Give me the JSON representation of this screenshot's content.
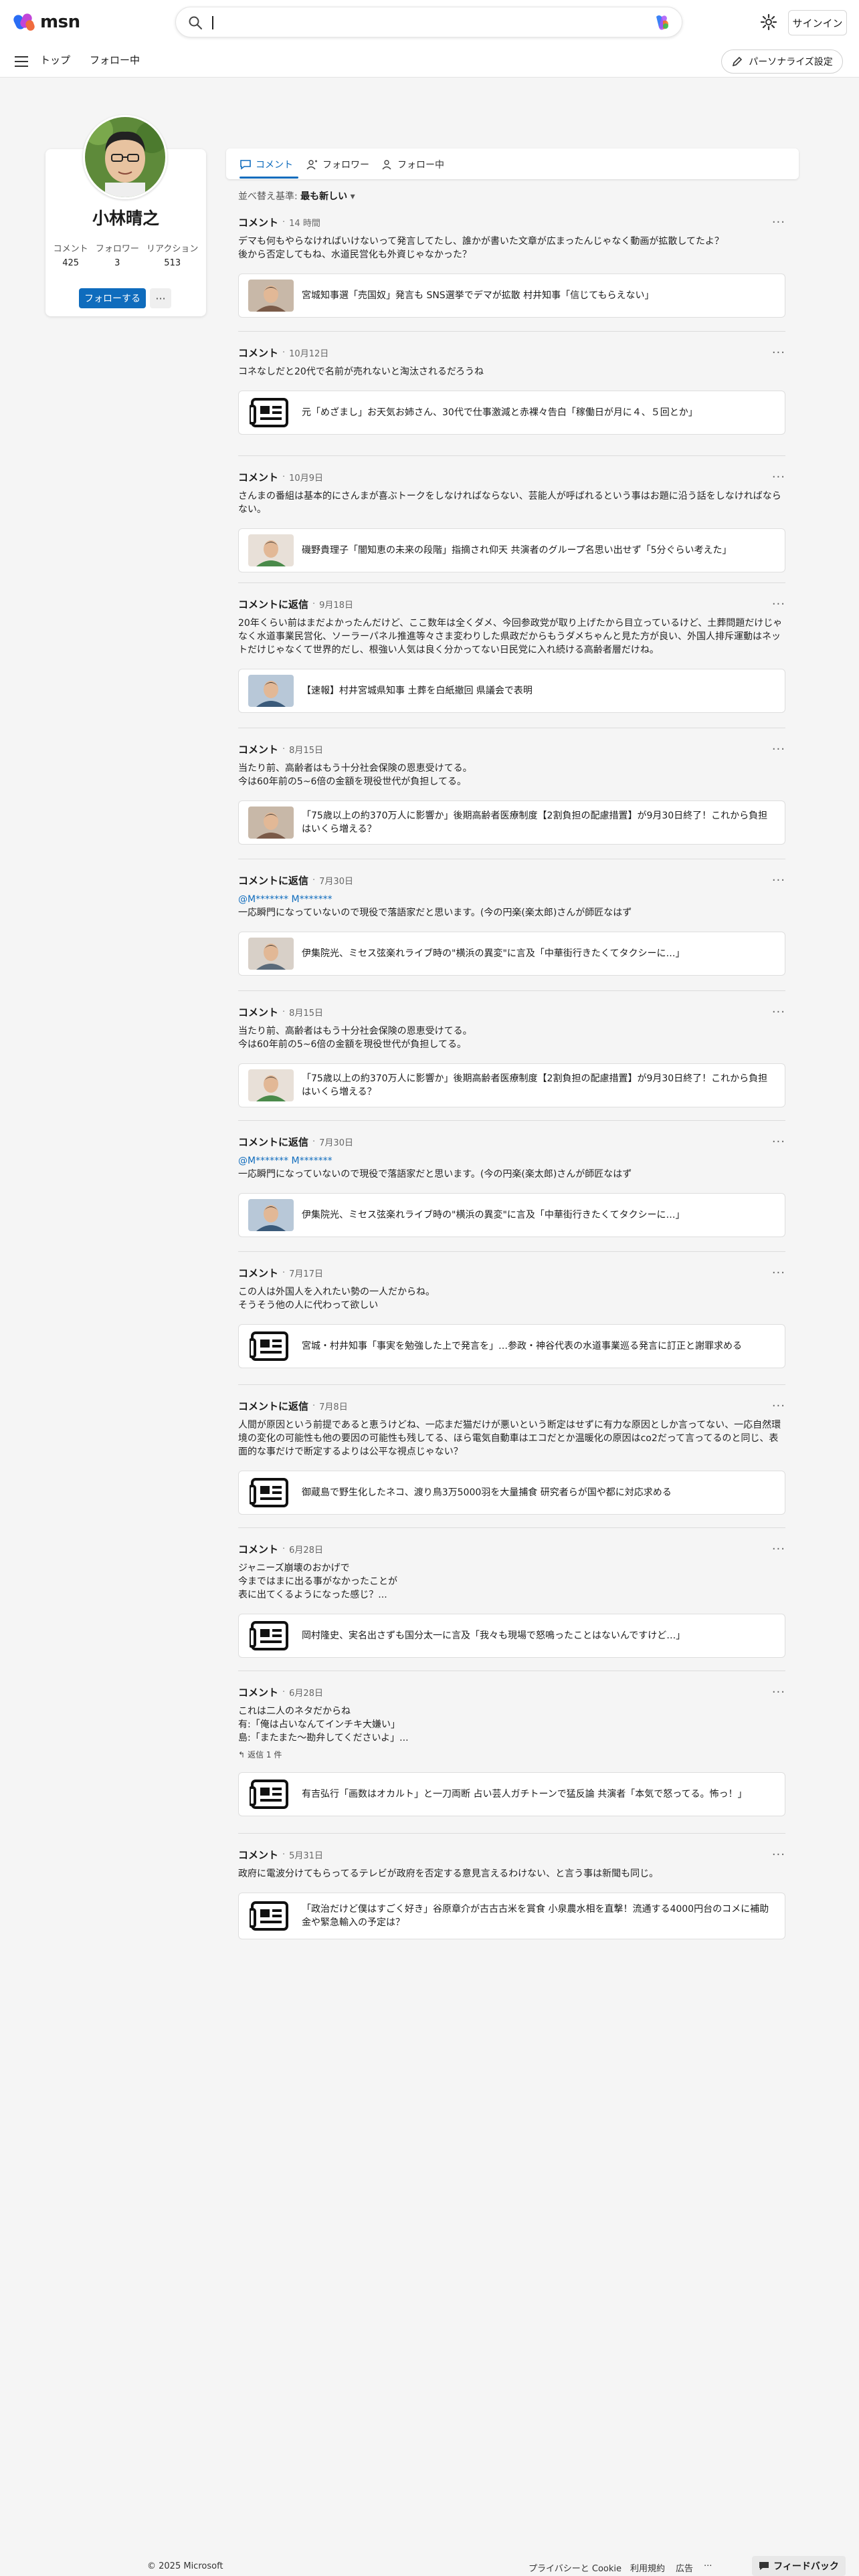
{
  "header": {
    "logo_text": "msn",
    "search_placeholder": "",
    "signin_label": "サインイン"
  },
  "nav": {
    "items": [
      "トップ",
      "フォロー中"
    ],
    "personalize_label": "パーソナライズ設定"
  },
  "profile": {
    "name": "小林晴之",
    "stats": [
      {
        "label": "コメント",
        "value": "425"
      },
      {
        "label": "フォロワー",
        "value": "3"
      },
      {
        "label": "リアクション",
        "value": "513"
      }
    ],
    "follow_label": "フォローする",
    "more_label": "···"
  },
  "tabs": [
    {
      "label": "コメント",
      "icon": "comment-icon",
      "active": true
    },
    {
      "label": "フォロワー",
      "icon": "followers-icon",
      "active": false
    },
    {
      "label": "フォロー中",
      "icon": "following-icon",
      "active": false
    }
  ],
  "sort": {
    "prefix": "並べ替え基準:",
    "value": "最も新しい"
  },
  "comments": [
    {
      "type": "コメント",
      "time": "14 時間",
      "body": "デマも何もやらなければいけないって発言してたし、誰かが書いた文章が広まったんじゃなく動画が拡散してたよ？\n後から否定してもね、水道民営化も外資じゃなかった？",
      "article": "宮城知事選「売国奴」発言も SNS選挙でデマが拡散 村井知事「信じてもらえない」",
      "thumb": "photo"
    },
    {
      "type": "コメント",
      "time": "10月12日",
      "body": "コネなしだと20代で名前が売れないと淘汰されるだろうね",
      "article": "元「めざまし」お天気お姉さん、30代で仕事激減と赤裸々告白「稼働日が月に４、５回とか」",
      "thumb": "news"
    },
    {
      "type": "コメント",
      "time": "10月9日",
      "body": "さんまの番組は基本的にさんまが喜ぶトークをしなければならない、芸能人が呼ばれるという事はお題に沿う話をしなければならない。",
      "article": "磯野貴理子「闇知恵の未来の段階」指摘され仰天 共演者のグループ名思い出せず「5分ぐらい考えた」",
      "thumb": "photo"
    },
    {
      "type": "コメントに返信",
      "time": "9月18日",
      "body": "20年くらい前はまだよかったんだけど、ここ数年は全くダメ、今回参政党が取り上げたから目立っているけど、土葬問題だけじゃなく水道事業民営化、ソーラーパネル推進等々さま変わりした県政だからもうダメちゃんと見た方が良い、外国人排斥運動はネットだけじゃなくて世界的だし、根強い人気は良く分かってない日民党に入れ続ける高齢者層だけね。",
      "article": "【速報】村井宮城県知事 土葬を白紙撤回 県議会で表明",
      "thumb": "photo"
    },
    {
      "type": "コメント",
      "time": "8月15日",
      "body": "当たり前、高齢者はもう十分社会保険の恩恵受けてる。\n今は60年前の5~6倍の金額を現役世代が負担してる。",
      "article": "「75歳以上の約370万人に影響か」後期高齢者医療制度【2割負担の配慮措置】が9月30日終了！これから負担はいくら増える？",
      "thumb": "photo"
    },
    {
      "type": "コメントに返信",
      "time": "7月30日",
      "mention": "@M******* M*******",
      "body": "一応瞬門になっていないので現役で落語家だと思います。(今の円楽(楽太郎)さんが師匠なはず",
      "article": "伊集院光、ミセス弦楽れライブ時の\"横浜の異変\"に言及「中華街行きたくてタクシーに…」",
      "thumb": "photo"
    },
    {
      "type": "コメント",
      "time": "8月15日",
      "body": "当たり前、高齢者はもう十分社会保険の恩恵受けてる。\n今は60年前の5~6倍の金額を現役世代が負担してる。",
      "article": "「75歳以上の約370万人に影響か」後期高齢者医療制度【2割負担の配慮措置】が9月30日終了！これから負担はいくら増える？",
      "thumb": "photo"
    },
    {
      "type": "コメントに返信",
      "time": "7月30日",
      "mention": "@M******* M*******",
      "body": "一応瞬門になっていないので現役で落語家だと思います。(今の円楽(楽太郎)さんが師匠なはず",
      "article": "伊集院光、ミセス弦楽れライブ時の\"横浜の異変\"に言及「中華街行きたくてタクシーに…」",
      "thumb": "photo"
    },
    {
      "type": "コメント",
      "time": "7月17日",
      "body": "この人は外国人を入れたい勢の一人だからね。\nそうそう他の人に代わって欲しい",
      "article": "宮城・村井知事「事実を勉強した上で発言を」…参政・神谷代表の水道事業巡る発言に訂正と謝罪求める",
      "thumb": "news"
    },
    {
      "type": "コメントに返信",
      "time": "7月8日",
      "body": "人間が原因という前提であると恵うけどね、一応まだ猫だけが悪いという断定はせずに有力な原因としか言ってない、一応自然環境の変化の可能性も他の要因の可能性も残してる、ほら電気自動車はエコだとか温暖化の原因はco2だって言ってるのと同じ、表面的な事だけで断定するよりは公平な視点じゃない？",
      "article": "御蔵島で野生化したネコ、渡り鳥3万5000羽を大量捕食 研究者らが国や都に対応求める",
      "thumb": "news"
    },
    {
      "type": "コメント",
      "time": "6月28日",
      "body": "ジャニーズ崩壊のおかげで\n今まではまに出る事がなかったことが\n表に出てくるようになった感じ？...",
      "article": "岡村隆史、実名出さずも国分太一に言及「我々も現場で怒鳴ったことはないんですけど…」",
      "thumb": "news"
    },
    {
      "type": "コメント",
      "time": "6月28日",
      "body": "これは二人のネタだからね\n有:「俺は占いなんてインチキ大嫌い」\n島:「またまた〜勘弁してくださいよ」...",
      "reply": "返信 1 件",
      "article": "有吉弘行「画数はオカルト」と一刀両断 占い芸人ガチトーンで猛反論 共演者「本気で怒ってる。怖っ！」",
      "thumb": "news"
    },
    {
      "type": "コメント",
      "time": "5月31日",
      "body": "政府に電波分けてもらってるテレビが政府を否定する意見言えるわけない、と言う事は新聞も同じ。",
      "article": "「政治だけど僕はすごく好き」谷原章介が古古古米を賞食 小泉農水相を直撃！流通する4000円台のコメに補助金や緊急輸入の予定は？",
      "thumb": "news"
    }
  ],
  "footer": {
    "copyright": "© 2025 Microsoft",
    "links": [
      "プライバシーと Cookie",
      "利用規約",
      "広告",
      "···"
    ],
    "feedback_label": "フィードバック"
  }
}
